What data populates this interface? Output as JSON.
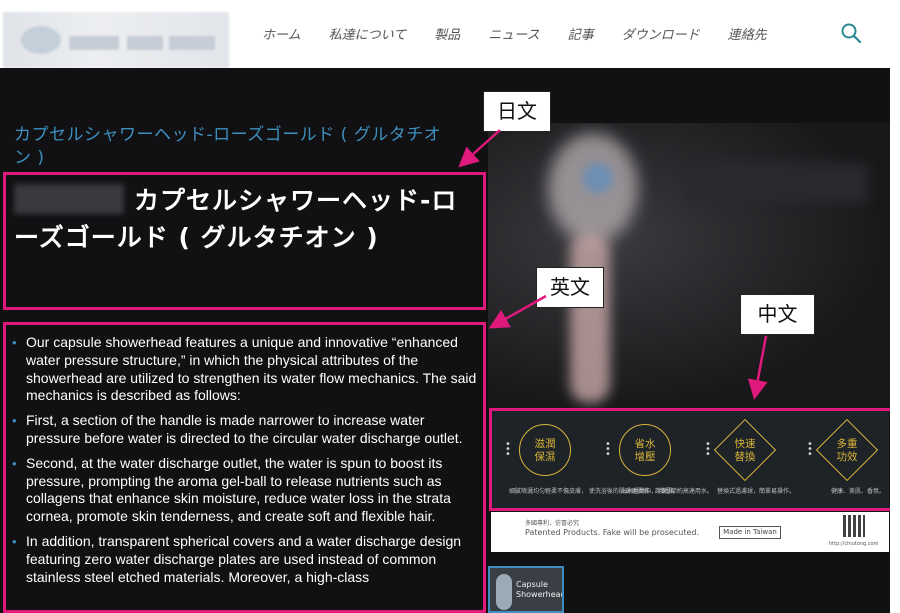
{
  "nav": {
    "items": [
      "ホーム",
      "私達について",
      "製品",
      "ニュース",
      "記事",
      "ダウンロード",
      "連絡先"
    ],
    "search_icon": "search-icon"
  },
  "product": {
    "category_link": "カプセルシャワーヘッド-ローズゴールド ( グルタチオン )",
    "title": "カプセルシャワーヘッド-ローズゴールド ( グルタチオン )",
    "description": [
      "Our capsule showerhead features a unique and innovative “enhanced water pressure structure,” in which the physical attributes of the showerhead are utilized to strengthen its water flow mechanics. The said mechanics is described as follows:",
      "First, a section of the handle is made narrower to increase water pressure before water is directed to the circular water discharge outlet.",
      "Second, at the water discharge outlet, the water is spun to boost its pressure, prompting the aroma gel-ball to release nutrients such as collagens that enhance skin moisture, reduce water loss in the strata cornea, promote skin tenderness, and create soft and flexible hair.",
      "In addition, transparent spherical covers and a water discharge design featuring zero water discharge plates are used instead of common stainless steel etched materials. Moreover, a high-class"
    ]
  },
  "features": [
    {
      "label": "滋潤\n保濕",
      "caption": "細膩噴灑均匀輕柔不傷皮膚，\n使洗浴後的肌膚更柔嫩、護保濕。"
    },
    {
      "label": "省水\n增壓",
      "caption": "出水量集中，\n增壓節約高達用水。"
    },
    {
      "label": "快速\n替換",
      "caption": "替換式過濾球，簡單易操作。"
    },
    {
      "label": "多重\n功效",
      "caption": "健康、美肌、香氛。"
    }
  ],
  "patent": {
    "line1": "多國專利．仿冒必究",
    "line2": "Patented Products.  Fake will be prosecuted.",
    "made_in": "Made in Taiwan",
    "url": "http://chiutong.com"
  },
  "thumbnail": {
    "text": "Capsule\nShowerhead"
  },
  "annotations": {
    "japanese": "日文",
    "english": "英文",
    "chinese": "中文"
  },
  "colors": {
    "accent": "#3d8fbf",
    "highlight": "#e0197d",
    "gold": "#d9b43a",
    "background": "#111113"
  }
}
